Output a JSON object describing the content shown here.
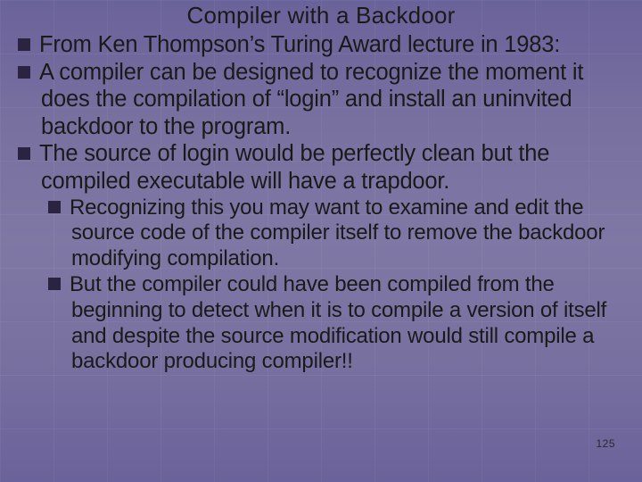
{
  "slide": {
    "title": "Compiler with a Backdoor",
    "bullets": [
      {
        "level": 1,
        "text": "From Ken Thompson’s Turing Award lecture in 1983:"
      },
      {
        "level": 1,
        "text": "A compiler can be designed to recognize the moment it does the compilation of “login” and install an uninvited backdoor to the program."
      },
      {
        "level": 1,
        "text": "The source of login would be perfectly clean but the compiled executable will have a trapdoor."
      },
      {
        "level": 2,
        "text": "Recognizing this you may want to examine and edit the source code of the compiler itself to remove the backdoor modifying compilation."
      },
      {
        "level": 2,
        "text": "But the compiler could have been compiled from the beginning to detect when it is to compile a version of itself and despite the source modification would still compile a backdoor producing compiler!!"
      }
    ],
    "page_number": "125"
  },
  "icons": {
    "bullet_char": "▪"
  }
}
